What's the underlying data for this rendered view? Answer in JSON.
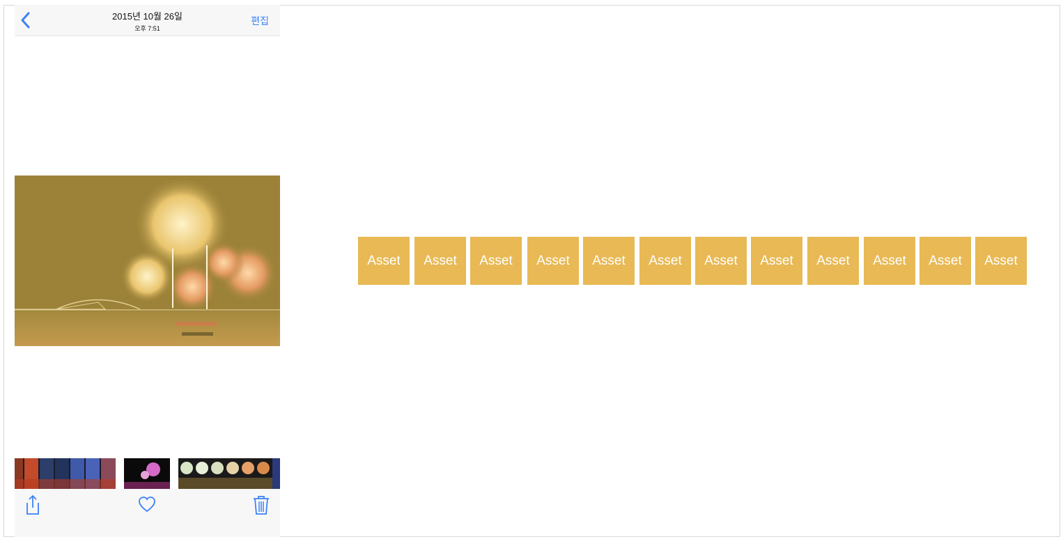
{
  "nav": {
    "title": "2015년 10월 26일",
    "subtitle": "오후 7:51",
    "edit_label": "편집"
  },
  "toolbar": {
    "share": "share-icon",
    "favorite": "heart-icon",
    "delete": "trash-icon"
  },
  "assets": [
    "Asset",
    "Asset",
    "Asset",
    "Asset",
    "Asset",
    "Asset",
    "Asset",
    "Asset",
    "Asset",
    "Asset",
    "Asset",
    "Asset"
  ],
  "colors": {
    "accent": "#3b82f6",
    "asset_fill": "#e8b954",
    "photo_tint": "#9c8238"
  }
}
